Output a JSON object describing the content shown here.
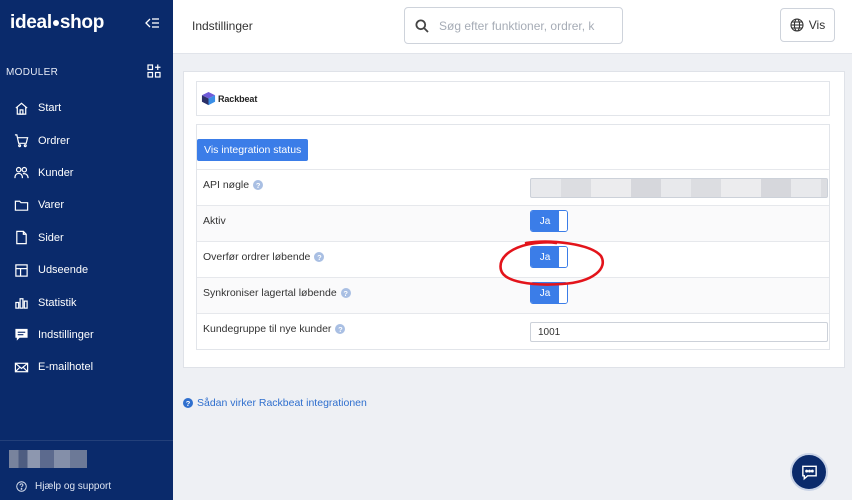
{
  "brand": {
    "logo_left": "ideal",
    "logo_right": "shop"
  },
  "sidebar": {
    "modules_label": "MODULER",
    "items": [
      {
        "label": "Start",
        "icon": "home-icon"
      },
      {
        "label": "Ordrer",
        "icon": "cart-icon"
      },
      {
        "label": "Kunder",
        "icon": "users-icon"
      },
      {
        "label": "Varer",
        "icon": "folder-icon"
      },
      {
        "label": "Sider",
        "icon": "file-icon"
      },
      {
        "label": "Udseende",
        "icon": "layout-icon"
      },
      {
        "label": "Statistik",
        "icon": "chart-icon"
      },
      {
        "label": "Indstillinger",
        "icon": "settings-message-icon"
      },
      {
        "label": "E-mailhotel",
        "icon": "mail-icon"
      }
    ],
    "help_label": "Hjælp og support"
  },
  "header": {
    "title": "Indstillinger",
    "search_placeholder": "Søg efter funktioner, ordrer, k",
    "view_button": "Vis"
  },
  "integration": {
    "logo_text": "Rackbeat",
    "status_button": "Vis integration status",
    "rows": [
      {
        "label": "API nøgle",
        "help": "?",
        "type": "masked"
      },
      {
        "label": "Aktiv",
        "type": "toggle",
        "value": "Ja"
      },
      {
        "label": "Overfør ordrer løbende",
        "help": "?",
        "type": "toggle",
        "value": "Ja"
      },
      {
        "label": "Synkroniser lagertal løbende",
        "help": "?",
        "type": "toggle",
        "value": "Ja"
      },
      {
        "label": "Kundegruppe til nye kunder",
        "help": "?",
        "type": "text",
        "value": "1001"
      }
    ],
    "howto_link": "Sådan virker Rackbeat integrationen",
    "howto_icon": "?"
  },
  "colors": {
    "sidebar": "#0a2a6b",
    "accent": "#3b7de8",
    "annotation": "#e3141b"
  }
}
